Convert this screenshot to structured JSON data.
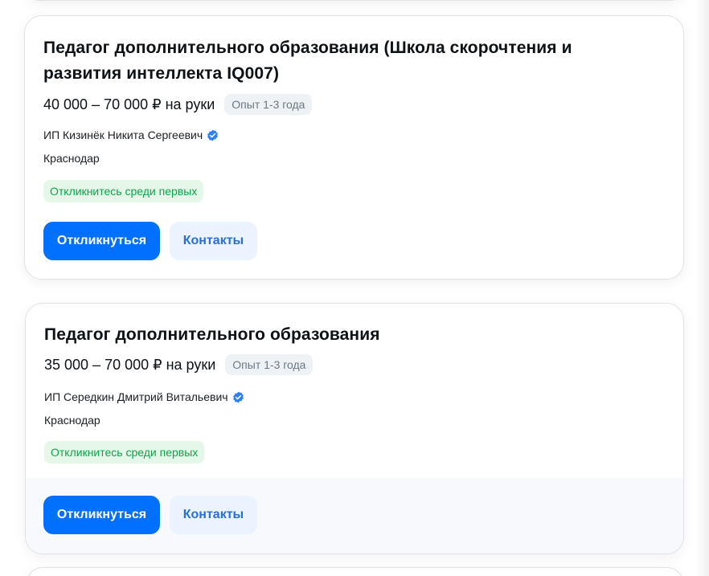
{
  "vacancies": [
    {
      "title": "Педагог дополнительного образования (Школа скорочтения и развития интеллекта IQ007)",
      "salary": "40 000 – 70 000 ₽ на руки",
      "experience": "Опыт 1-3 года",
      "company": "ИП Кизинёк Никита Сергеевич",
      "company_verified_icon": "verified-check-icon",
      "city": "Краснодар",
      "badge": "Откликнитесь среди первых",
      "apply_label": "Откликнуться",
      "contacts_label": "Контакты"
    },
    {
      "title": "Педагог дополнительного образования",
      "salary": "35 000 – 70 000 ₽ на руки",
      "experience": "Опыт 1-3 года",
      "company": "ИП Середкин Дмитрий Витальевич",
      "company_verified_icon": "verified-check-icon",
      "city": "Краснодар",
      "badge": "Откликнитесь среди первых",
      "apply_label": "Откликнуться",
      "contacts_label": "Контакты"
    }
  ],
  "colors": {
    "primary_button": "#0070ff",
    "secondary_button_bg": "#eaf3ff",
    "secondary_button_text": "#2a6fd6",
    "verified_icon": "#2d7ff9",
    "early_badge_bg": "#e5f7e9",
    "early_badge_text": "#0da44b",
    "experience_badge_bg": "#eff2f5",
    "experience_badge_text": "#6a7885"
  }
}
